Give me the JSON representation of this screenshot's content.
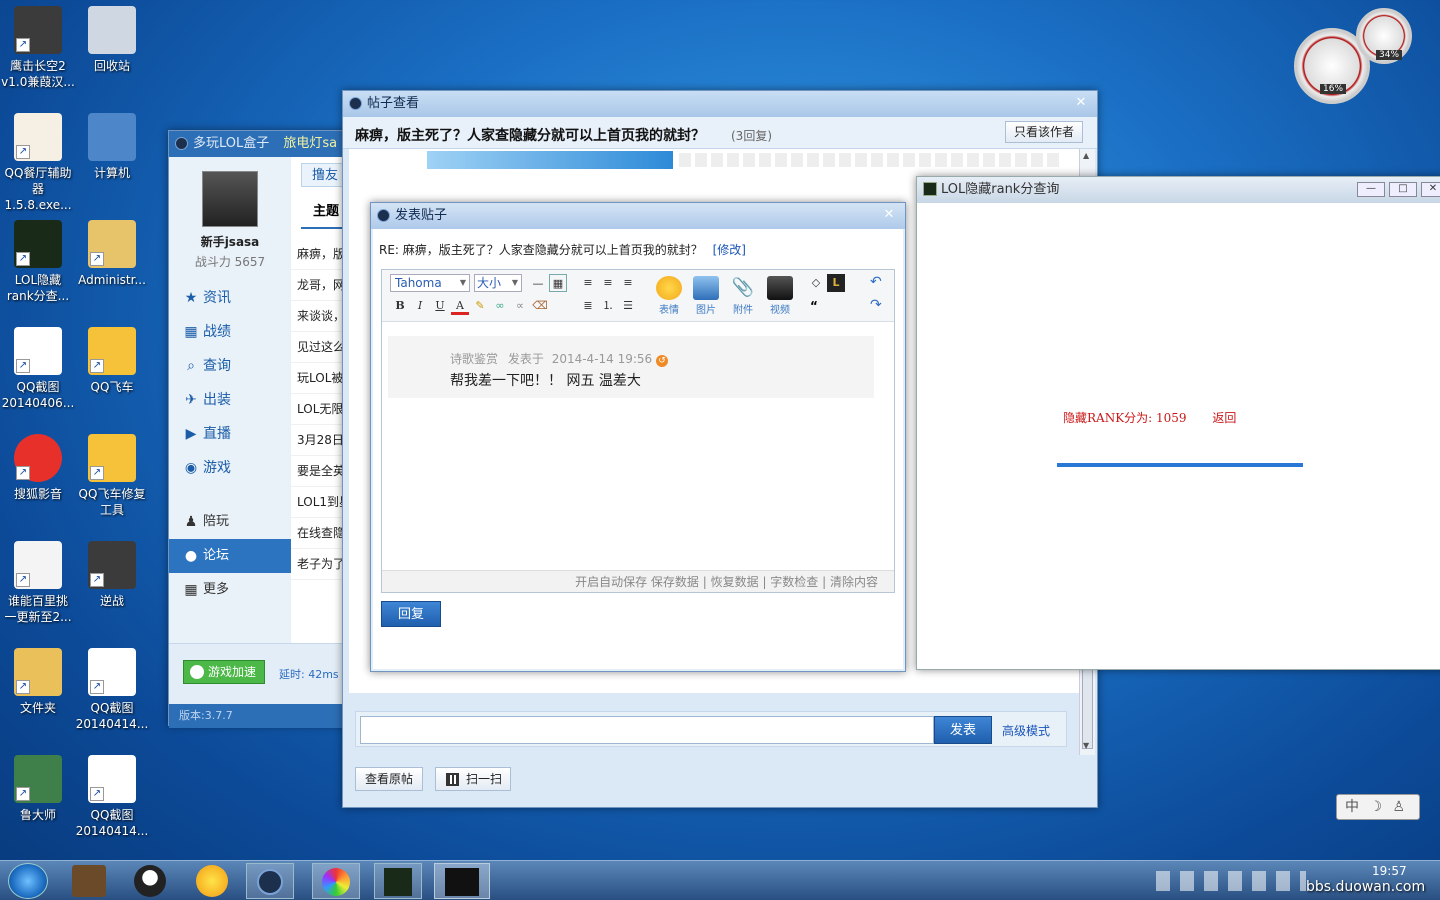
{
  "desktop_icons": [
    {
      "label": "鹰击长空2\nv1.0兼葭汉...",
      "icon": "game-icon"
    },
    {
      "label": "回收站",
      "icon": "recycle-bin-icon"
    },
    {
      "label": "QQ餐厅辅助\n器1.5.8.exe...",
      "icon": "chef-hat-icon"
    },
    {
      "label": "计算机",
      "icon": "computer-icon"
    },
    {
      "label": "LOL隐藏\nrank分查...",
      "icon": "lol-icon"
    },
    {
      "label": "Administr...",
      "icon": "user-folder-icon"
    },
    {
      "label": "QQ截图\n20140406...",
      "icon": "image-icon"
    },
    {
      "label": "QQ飞车",
      "icon": "qq-speed-icon"
    },
    {
      "label": "搜狐影音",
      "icon": "video-player-icon"
    },
    {
      "label": "QQ飞车修复\n工具",
      "icon": "qq-speed-icon"
    },
    {
      "label": "谁能百里挑\n一更新至2...",
      "icon": "document-icon"
    },
    {
      "label": "逆战",
      "icon": "game-icon"
    },
    {
      "label": "文件夹",
      "icon": "folder-icon"
    },
    {
      "label": "QQ截图\n20140414...",
      "icon": "image-icon"
    },
    {
      "label": "鲁大师",
      "icon": "ludashi-icon"
    },
    {
      "label": "QQ截图\n20140414...",
      "icon": "image-icon"
    }
  ],
  "gadget": {
    "cpu": "16%",
    "mem": "34%"
  },
  "lol_box": {
    "title": "多玩LOL盒子",
    "title_extra": "旅电灯sa",
    "username": "新手jsasa",
    "power": "战斗力 5657",
    "tab": "撸友",
    "subtab": "主题",
    "nav": [
      "资讯",
      "战绩",
      "查询",
      "出装",
      "直播",
      "游戏",
      "陪玩",
      "论坛",
      "更多"
    ],
    "active_nav": "论坛",
    "accel_btn": "游戏加速",
    "latency": "延时: 42ms",
    "version": "版本:3.7.7",
    "topics": [
      "麻痹，版",
      "龙哥，网",
      "来谈谈，",
      "见过这么",
      "玩LOL被",
      "LOL无限",
      "3月28日",
      "要是全英",
      "LOL1到星",
      "在线查隐",
      "老子为了"
    ]
  },
  "post_view": {
    "title": "帖子查看",
    "post_title": "麻痹，版主死了？人家查隐藏分就可以上首页我的就封？",
    "reply_count": "(3回复)",
    "only_author": "只看该作者",
    "send_btn": "发表",
    "advanced": "高级模式",
    "view_original": "查看原帖",
    "scan": "扫一扫"
  },
  "reply_dialog": {
    "title": "发表贴子",
    "re_line": "RE: 麻痹，版主死了？人家查隐藏分就可以上首页我的就封？",
    "modify": "[修改]",
    "font": "Tahoma",
    "size": "大小",
    "tools": [
      "表情",
      "图片",
      "附件",
      "视频"
    ],
    "quote_author": "诗歌鉴赏",
    "quote_prefix": "发表于",
    "quote_time": "2014-4-14 19:56",
    "quote_text": "帮我差一下吧！！ 网五 温差大",
    "footer": [
      "开启自动保存",
      "保存数据",
      "恢复数据",
      "字数检查",
      "清除内容"
    ],
    "reply_btn": "回复"
  },
  "rank_window": {
    "title": "LOL隐藏rank分查询",
    "result": "隐藏RANK分为: 1059",
    "back": "返回"
  },
  "taskbar": {
    "time": "19:57",
    "ime": "中",
    "watermark": "bbs.duowan.com"
  }
}
